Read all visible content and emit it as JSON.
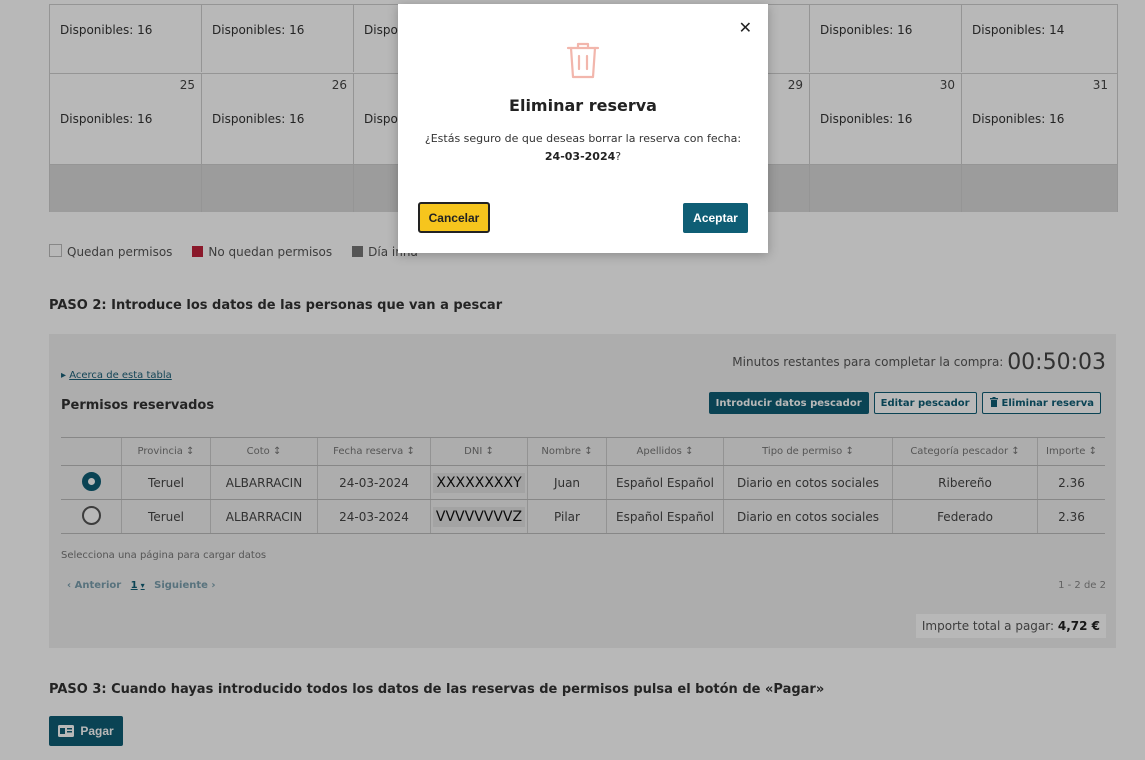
{
  "calendar": {
    "row1": [
      {
        "day": "",
        "avail": "Disponibles: 16"
      },
      {
        "day": "",
        "avail": "Disponibles: 16"
      },
      {
        "day": "",
        "avail": "Dispor"
      },
      {
        "day": "",
        "avail": ""
      },
      {
        "day": "",
        "avail": ""
      },
      {
        "day": "",
        "avail": "Disponibles: 16"
      },
      {
        "day": "",
        "avail": "Disponibles: 14"
      }
    ],
    "row2": [
      {
        "day": "25",
        "avail": "Disponibles: 16"
      },
      {
        "day": "26",
        "avail": "Disponibles: 16"
      },
      {
        "day": "",
        "avail": "Dispor"
      },
      {
        "day": "",
        "avail": ""
      },
      {
        "day": "29",
        "avail": ""
      },
      {
        "day": "30",
        "avail": "Disponibles: 16"
      },
      {
        "day": "31",
        "avail": "Disponibles: 16"
      }
    ]
  },
  "legend": {
    "items": [
      {
        "label": "Quedan permisos",
        "color": "#ffffff"
      },
      {
        "label": "No quedan permisos",
        "color": "#c0223b"
      },
      {
        "label": "Día inhá",
        "color": "#777777"
      }
    ]
  },
  "step2": {
    "title": "PASO 2: Introduce los datos de las personas que van a pescar"
  },
  "panel": {
    "about_link": "Acerca de esta tabla",
    "timer_label": "Minutos restantes para completar la compra:",
    "timer_value": "00:50:03",
    "title": "Permisos reservados",
    "actions": {
      "add": "Introducir datos pescador",
      "edit": "Editar pescador",
      "delete": "Eliminar reserva"
    },
    "headers": [
      "",
      "Provincia",
      "Coto",
      "Fecha reserva",
      "DNI",
      "Nombre",
      "Apellidos",
      "Tipo de permiso",
      "Categoría pescador",
      "Importe"
    ],
    "rows": [
      {
        "selected": true,
        "provincia": "Teruel",
        "coto": "ALBARRACIN",
        "fecha": "24-03-2024",
        "dni": "XXXXXXXXY",
        "nombre": "Juan",
        "apellidos": "Español Español",
        "tipo": "Diario en cotos sociales",
        "categoria": "Ribereño",
        "importe": "2.36"
      },
      {
        "selected": false,
        "provincia": "Teruel",
        "coto": "ALBARRACIN",
        "fecha": "24-03-2024",
        "dni": "VVVVVVVVZ",
        "nombre": "Pilar",
        "apellidos": "Español Español",
        "tipo": "Diario en cotos sociales",
        "categoria": "Federado",
        "importe": "2.36"
      }
    ],
    "pager_hint": "Selecciona una página para cargar datos",
    "pager": {
      "prev": "‹ Anterior",
      "current": "1",
      "next": "Siguiente ›"
    },
    "count": "1 - 2 de 2",
    "total_label": "Importe total a pagar:",
    "total_value": "4,72 €"
  },
  "step3": {
    "title": "PASO 3: Cuando hayas introducido todos los datos de las reservas de permisos pulsa el botón de «Pagar»"
  },
  "pay_button": "Pagar",
  "modal": {
    "title": "Eliminar reserva",
    "message": "¿Estás seguro de que deseas borrar la reserva con fecha:",
    "date": "24-03-2024",
    "suffix": "?",
    "cancel": "Cancelar",
    "accept": "Aceptar"
  }
}
